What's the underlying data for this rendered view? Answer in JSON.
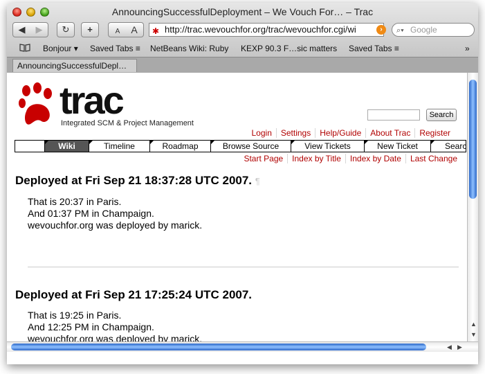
{
  "window": {
    "title": "AnnouncingSuccessfulDeployment – We Vouch For… – Trac"
  },
  "toolbar": {
    "back_icon": "◀",
    "forward_icon": "▶",
    "reload_icon": "↻",
    "add_bookmark_icon": "+",
    "text_small": "A",
    "text_large": "A",
    "url": "http://trac.wevouchfor.org/trac/wevouchfor.cgi/wi",
    "search_placeholder": "Google"
  },
  "bookmarks": {
    "items": [
      "Bonjour ▾",
      "Saved Tabs ≡",
      "NetBeans Wiki: Ruby",
      "KEXP 90.3 F…sic matters",
      "Saved Tabs ≡"
    ],
    "overflow": "»"
  },
  "tab": {
    "label": "AnnouncingSuccessfulDepl…"
  },
  "trac": {
    "logo_word": "trac",
    "tagline": "Integrated SCM & Project Management",
    "search_button": "Search",
    "metanav": [
      "Login",
      "Settings",
      "Help/Guide",
      "About Trac",
      "Register"
    ],
    "mainnav": [
      "Wiki",
      "Timeline",
      "Roadmap",
      "Browse Source",
      "View Tickets",
      "New Ticket",
      "Search"
    ],
    "ctxtnav": [
      "Start Page",
      "Index by Title",
      "Index by Date",
      "Last Change"
    ]
  },
  "posts": [
    {
      "heading": "Deployed at Fri Sep 21 18:37:28 UTC 2007.",
      "pilcrow": "¶",
      "lines": [
        "That is 20:37 in Paris.",
        "And 01:37 PM in Champaign.",
        "wevouchfor.org was deployed by marick."
      ]
    },
    {
      "heading": "Deployed at Fri Sep 21 17:25:24 UTC 2007.",
      "lines": [
        "That is 19:25 in Paris.",
        "And 12:25 PM in Champaign.",
        "wevouchfor.org was deployed by marick."
      ]
    }
  ],
  "colors": {
    "link": "#b00000",
    "active_nav": "#555555",
    "scroll_thumb": "#2c68c8"
  }
}
